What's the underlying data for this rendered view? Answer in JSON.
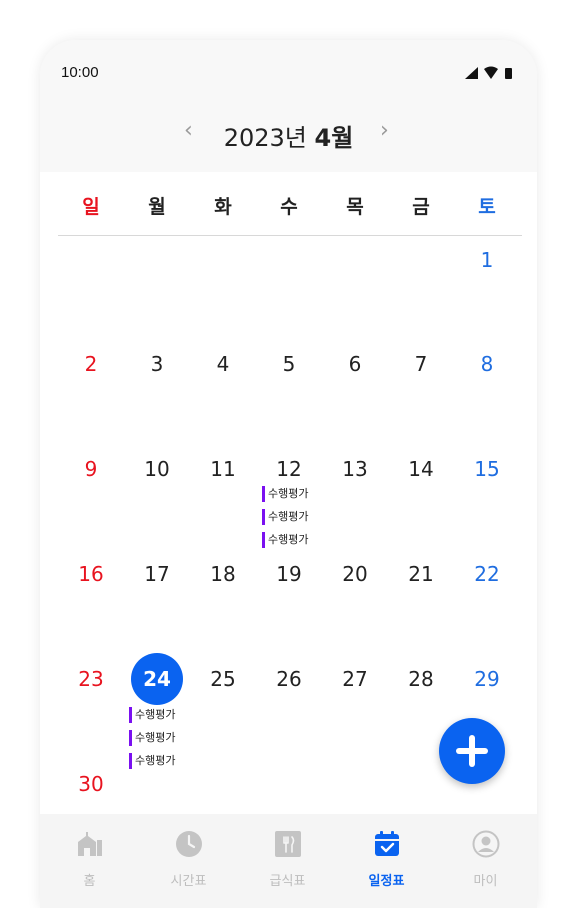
{
  "status": {
    "time": "10:00"
  },
  "header": {
    "prev": "‹",
    "next": "›",
    "year_text": "2023년",
    "month_text": "4월"
  },
  "weekdays": [
    "일",
    "월",
    "화",
    "수",
    "목",
    "금",
    "토"
  ],
  "weeks": [
    [
      "",
      "",
      "",
      "",
      "",
      "",
      "1"
    ],
    [
      "2",
      "3",
      "4",
      "5",
      "6",
      "7",
      "8"
    ],
    [
      "9",
      "10",
      "11",
      "12",
      "13",
      "14",
      "15"
    ],
    [
      "16",
      "17",
      "18",
      "19",
      "20",
      "21",
      "22"
    ],
    [
      "23",
      "24",
      "25",
      "26",
      "27",
      "28",
      "29"
    ],
    [
      "30",
      "",
      "",
      "",
      "",
      "",
      ""
    ]
  ],
  "events": {
    "day_12": [
      "수행평가",
      "수행평가",
      "수행평가"
    ],
    "day_24": [
      "수행평가",
      "수행평가",
      "수행평가"
    ]
  },
  "today": "24",
  "colors": {
    "accent": "#0a63f0",
    "sunday": "#e8131f",
    "saturday": "#1f6de0",
    "event_bar": "#7a10f0"
  },
  "tabs": [
    {
      "label": "홈",
      "icon": "school-icon"
    },
    {
      "label": "시간표",
      "icon": "clock-icon"
    },
    {
      "label": "급식표",
      "icon": "meal-icon"
    },
    {
      "label": "일정표",
      "icon": "calendar-check-icon"
    },
    {
      "label": "마이",
      "icon": "profile-icon"
    }
  ],
  "active_tab": "일정표"
}
